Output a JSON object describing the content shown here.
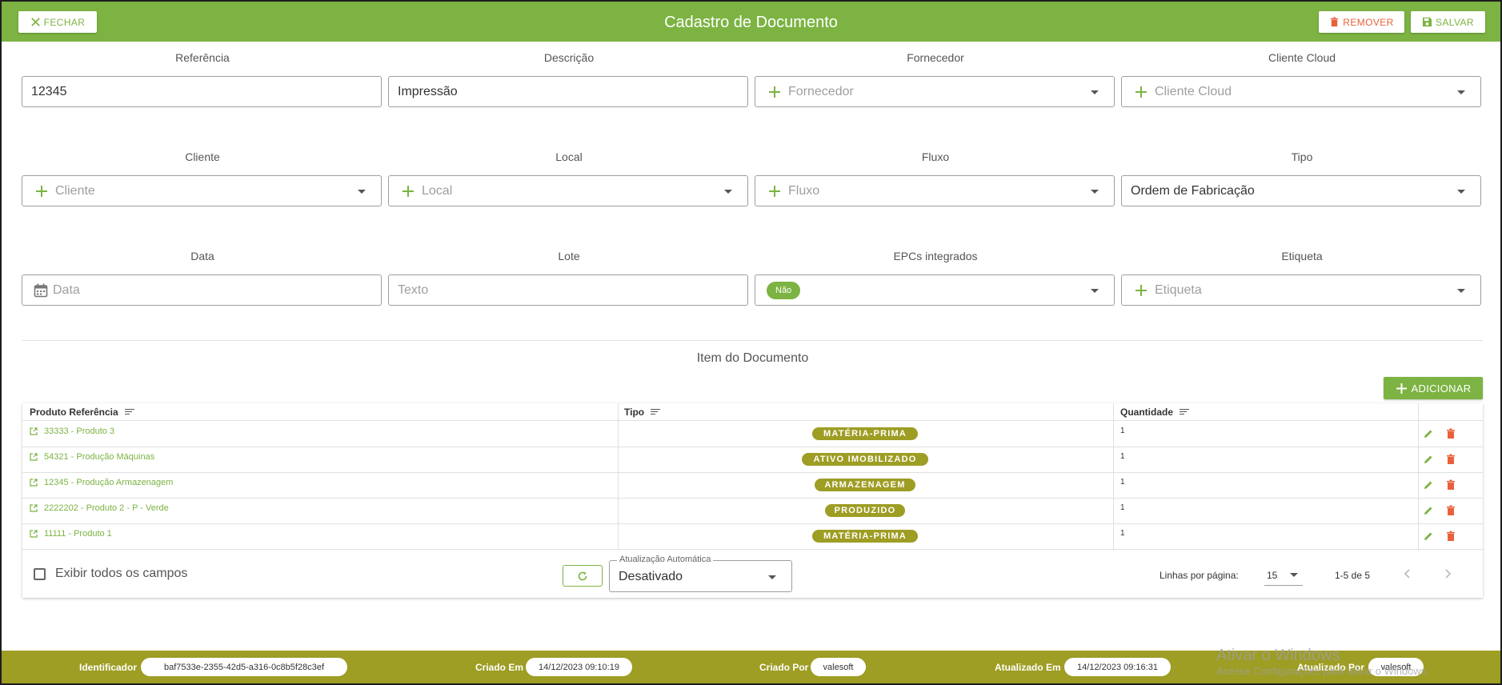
{
  "header": {
    "title": "Cadastro de Documento",
    "close_label": "FECHAR",
    "remove_label": "REMOVER",
    "save_label": "SALVAR"
  },
  "form": {
    "referencia": {
      "label": "Referência",
      "value": "12345"
    },
    "descricao": {
      "label": "Descrição",
      "value": "Impressão"
    },
    "fornecedor": {
      "label": "Fornecedor",
      "placeholder": "Fornecedor"
    },
    "cliente_cloud": {
      "label": "Cliente Cloud",
      "placeholder": "Cliente Cloud"
    },
    "cliente": {
      "label": "Cliente",
      "placeholder": "Cliente"
    },
    "local": {
      "label": "Local",
      "placeholder": "Local"
    },
    "fluxo": {
      "label": "Fluxo",
      "placeholder": "Fluxo"
    },
    "tipo": {
      "label": "Tipo",
      "value": "Ordem de Fabricação"
    },
    "data": {
      "label": "Data",
      "placeholder": "Data"
    },
    "lote": {
      "label": "Lote",
      "placeholder": "Texto"
    },
    "epcs": {
      "label": "EPCs integrados",
      "value": "Não"
    },
    "etiqueta": {
      "label": "Etiqueta",
      "placeholder": "Etiqueta"
    }
  },
  "items": {
    "section_title": "Item do Documento",
    "add_label": "ADICIONAR",
    "columns": [
      "Produto Referência",
      "Tipo",
      "Quantidade"
    ],
    "rows": [
      {
        "produto": "33333 - Produto 3",
        "tipo": "MATÉRIA-PRIMA",
        "quantidade": "1"
      },
      {
        "produto": "54321 - Produção Máquinas",
        "tipo": "ATIVO IMOBILIZADO",
        "quantidade": "1"
      },
      {
        "produto": "12345 - Produção Armazenagem",
        "tipo": "ARMAZENAGEM",
        "quantidade": "1"
      },
      {
        "produto": "2222202 - Produto 2 - P - Verde",
        "tipo": "PRODUZIDO",
        "quantidade": "1"
      },
      {
        "produto": "11111 - Produto 1",
        "tipo": "MATÉRIA-PRIMA",
        "quantidade": "1"
      }
    ],
    "show_all_label": "Exibir todos os campos",
    "auto_update_label": "Atualização Automática",
    "auto_update_value": "Desativado",
    "rows_per_page_label": "Linhas por página:",
    "rows_per_page": "15",
    "range": "1-5 de 5"
  },
  "footer": {
    "identificador_label": "Identificador",
    "identificador": "baf7533e-2355-42d5-a316-0c8b5f28c3ef",
    "criado_em_label": "Criado Em",
    "criado_em": "14/12/2023 09:10:19",
    "criado_por_label": "Criado Por",
    "criado_por": "valesoft",
    "atualizado_em_label": "Atualizado Em",
    "atualizado_em": "14/12/2023 09:16:31",
    "atualizado_por_label": "Atualizado Por",
    "atualizado_por": "valesoft"
  },
  "watermark": {
    "line1": "Ativar o Windows",
    "line2": "Acesse Configurações para ativar o Windows."
  },
  "colors": {
    "primary": "#7cb342",
    "olive": "#9e9d24",
    "danger": "#e8613a"
  }
}
